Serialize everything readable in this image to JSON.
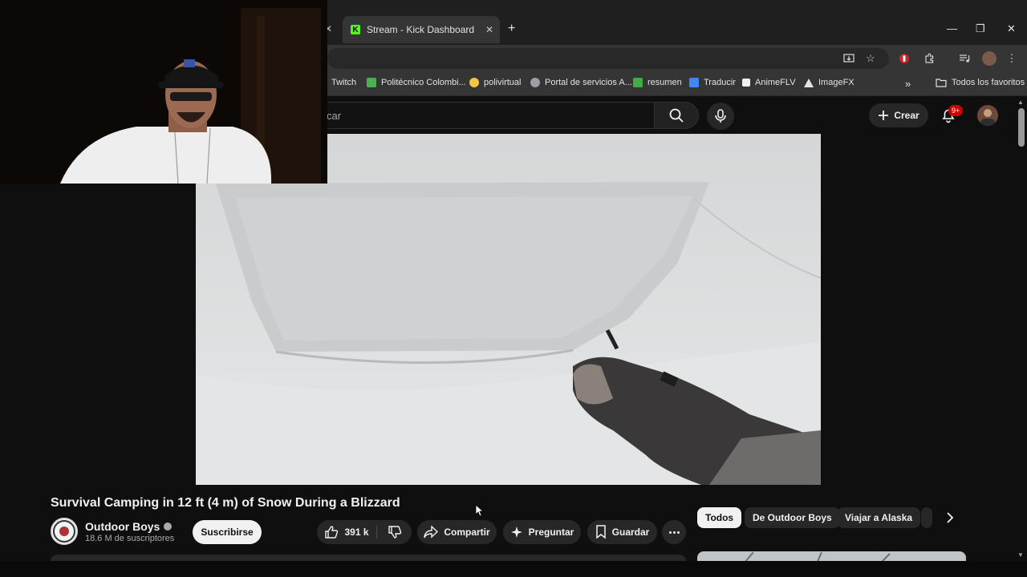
{
  "browser": {
    "active_tab": {
      "title": "Stream - Kick Dashboard",
      "icon": "kick-icon"
    },
    "prev_tab_close": "✕",
    "new_tab": "+",
    "window_controls": {
      "minimize": "—",
      "restore": "❐",
      "close": "✕"
    },
    "bookmarks": [
      {
        "label": "Twitch",
        "icon": "twitch-icon",
        "color": "#9146ff"
      },
      {
        "label": "Politécnico Colombi...",
        "icon": "politecnico-icon",
        "color": "#4caf50"
      },
      {
        "label": "polivirtual",
        "icon": "hand-icon",
        "color": "#f4c542"
      },
      {
        "label": "Portal de servicios A...",
        "icon": "globe-icon",
        "color": "#9aa0a6"
      },
      {
        "label": "resumen",
        "icon": "resumen-icon",
        "color": "#3fae49"
      },
      {
        "label": "Traducir",
        "icon": "translate-icon",
        "color": "#4285f4"
      },
      {
        "label": "AnimeFLV",
        "icon": "animeflv-icon",
        "color": "#f0f0f0"
      },
      {
        "label": "ImageFX",
        "icon": "imagefx-icon",
        "color": "#e3e3e3"
      }
    ],
    "bookmarks_overflow": "»",
    "all_bookmarks": "Todos los favoritos"
  },
  "youtube": {
    "search_placeholder": "car",
    "create_label": "Crear",
    "notifications_badge": "9+",
    "video": {
      "title": "Survival Camping in 12 ft (4 m) of Snow During a Blizzard",
      "channel": "Outdoor Boys",
      "subscribers": "18.6 M de suscriptores",
      "subscribe_label": "Suscribirse",
      "likes": "391 k",
      "share_label": "Compartir",
      "ask_label": "Preguntar",
      "save_label": "Guardar"
    },
    "chips": [
      {
        "label": "Todos",
        "active": true
      },
      {
        "label": "De Outdoor Boys",
        "active": false
      },
      {
        "label": "Viajar a Alaska",
        "active": false
      }
    ]
  },
  "colors": {
    "page_bg": "#0f0f0f",
    "chrome_tabstrip": "#1f1f1f",
    "chrome_toolbar": "#353535",
    "kick_green": "#53fc18",
    "notification_red": "#cc0000"
  }
}
